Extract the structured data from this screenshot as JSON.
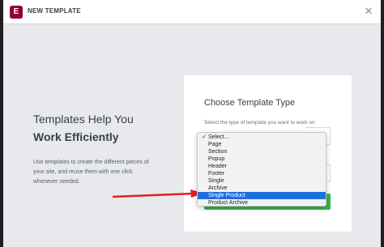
{
  "dialog": {
    "title": "NEW TEMPLATE",
    "logo_glyph": "E",
    "close_glyph": "✕"
  },
  "intro": {
    "heading_line1": "Templates Help You",
    "heading_line2": "Work Efficiently",
    "description": "Use templates to create the different pieces of your site, and reuse them with one click whenever needed."
  },
  "form": {
    "title": "Choose Template Type",
    "type_label": "Select the type of template you want to work on",
    "create_button_color": "#39b54a"
  },
  "dropdown": {
    "checked_glyph": "✓",
    "options": [
      "Select...",
      "Page",
      "Section",
      "Popup",
      "Header",
      "Footer",
      "Single",
      "Archive",
      "Single Product",
      "Product Archive"
    ],
    "checked_index": 0,
    "highlighted_index": 8,
    "highlight_color": "#1b6fe0"
  },
  "annotation": {
    "arrow_color": "#e02020"
  }
}
